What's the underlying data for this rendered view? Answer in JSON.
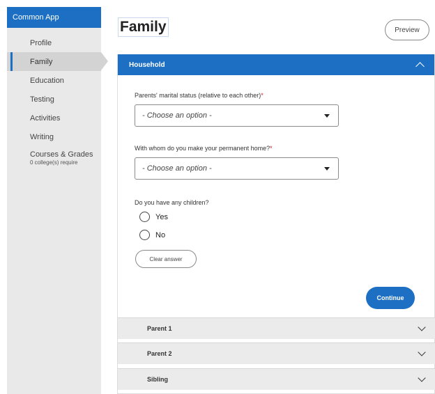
{
  "sidebar": {
    "brand": "Common App",
    "items": [
      {
        "label": "Profile"
      },
      {
        "label": "Family"
      },
      {
        "label": "Education"
      },
      {
        "label": "Testing"
      },
      {
        "label": "Activities"
      },
      {
        "label": "Writing"
      },
      {
        "label": "Courses & Grades",
        "sub": "0 college(s) require"
      }
    ],
    "active": "Family"
  },
  "page": {
    "title": "Family",
    "preview_label": "Preview"
  },
  "household": {
    "title": "Household",
    "marital_status": {
      "label": "Parents' marital status (relative to each other)",
      "required_mark": "*",
      "value": "- Choose an option -"
    },
    "permanent_home": {
      "label": "With whom do you make your permanent home?",
      "required_mark": "*",
      "value": "- Choose an option -"
    },
    "children": {
      "label": "Do you have any children?",
      "options": [
        "Yes",
        "No"
      ],
      "clear_label": "Clear answer"
    },
    "continue_label": "Continue"
  },
  "sections": [
    "Parent 1",
    "Parent 2",
    "Sibling"
  ],
  "colors": {
    "accent": "#1d6fc4",
    "required": "#c0272d"
  }
}
